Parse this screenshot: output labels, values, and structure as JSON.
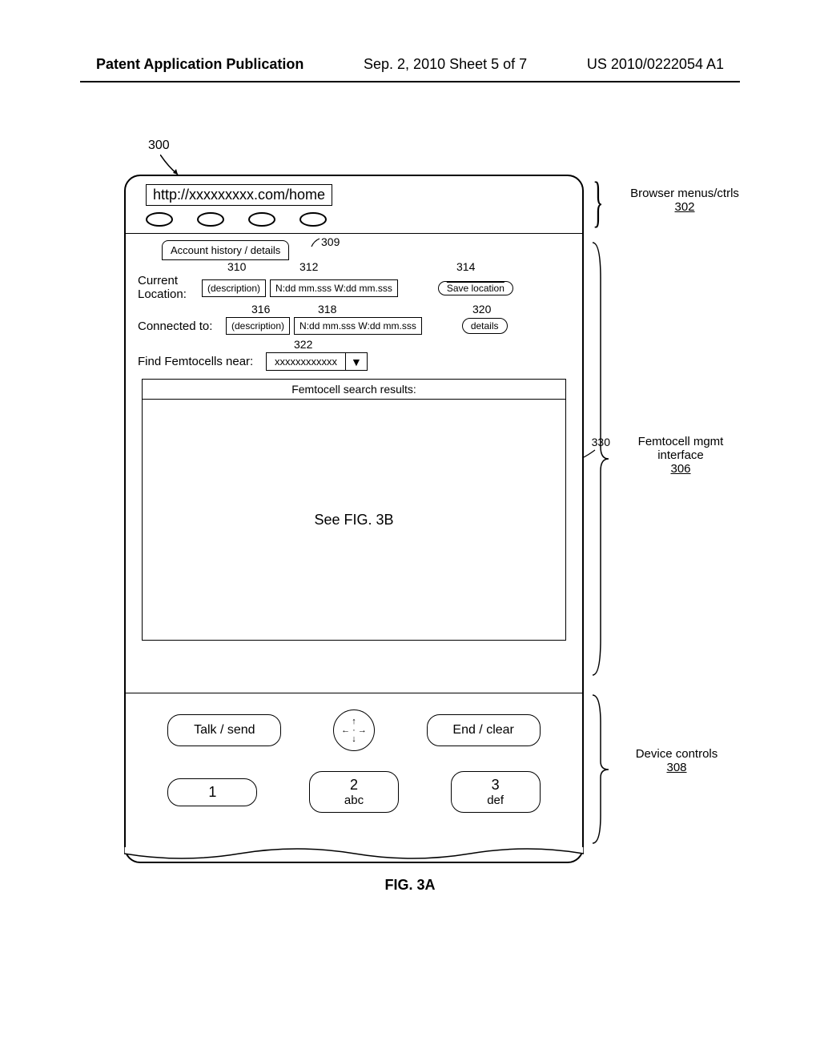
{
  "header": {
    "left": "Patent Application Publication",
    "center": "Sep. 2, 2010  Sheet 5 of 7",
    "right": "US 2010/0222054 A1"
  },
  "refs": {
    "r300": "300",
    "r302_label": "Browser menus/ctrls",
    "r302_num": "302",
    "r306_label": "Femtocell mgmt interface",
    "r306_num": "306",
    "r308_label": "Device controls",
    "r308_num": "308",
    "r309": "309",
    "r310": "310",
    "r312": "312",
    "r314": "314",
    "r316": "316",
    "r318": "318",
    "r320": "320",
    "r322": "322",
    "r330": "330"
  },
  "browser": {
    "url": "http://xxxxxxxxx.com/home"
  },
  "interface": {
    "tab_label": "Account history / details",
    "current_location_label": "Current Location:",
    "description_placeholder": "(description)",
    "coords_placeholder": "N:dd mm.sss W:dd mm.sss",
    "save_location_btn": "Save location",
    "connected_to_label": "Connected to:",
    "details_btn": "details",
    "find_label": "Find Femtocells near:",
    "dropdown_value": "xxxxxxxxxxxx",
    "results_header": "Femtocell search results:",
    "results_body": "See FIG. 3B"
  },
  "controls": {
    "talk_send": "Talk / send",
    "end_clear": "End / clear",
    "keys": [
      {
        "num": "1",
        "letters": ""
      },
      {
        "num": "2",
        "letters": "abc"
      },
      {
        "num": "3",
        "letters": "def"
      }
    ]
  },
  "caption": "FIG. 3A"
}
